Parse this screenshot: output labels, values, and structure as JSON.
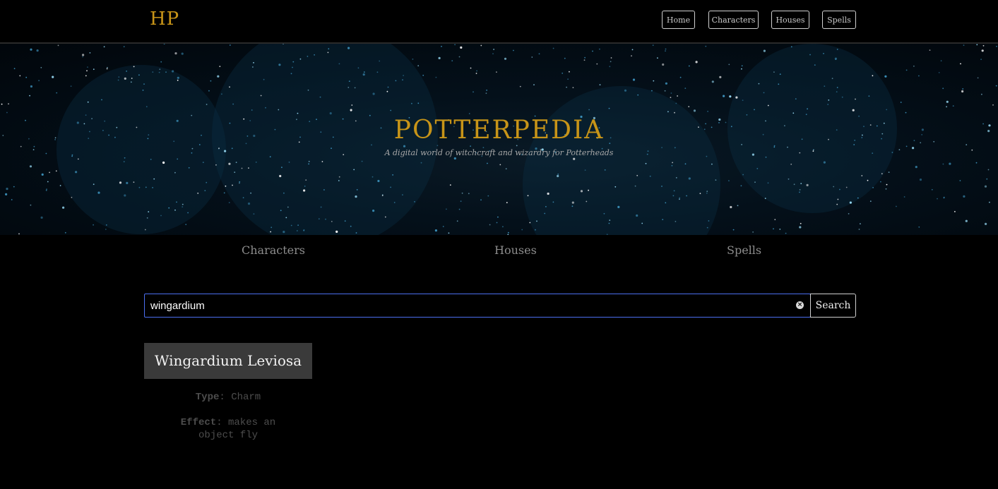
{
  "topbar": {
    "logo": "HP",
    "nav": [
      {
        "label": "Home"
      },
      {
        "label": "Characters"
      },
      {
        "label": "Houses"
      },
      {
        "label": "Spells"
      }
    ]
  },
  "hero": {
    "title": "POTTERPEDIA",
    "subtitle": "A digital world of witchcraft and wizardry for Potterheads"
  },
  "sections": [
    {
      "label": "Characters"
    },
    {
      "label": "Houses"
    },
    {
      "label": "Spells"
    }
  ],
  "search": {
    "value": "wingardium",
    "button_label": "Search"
  },
  "result": {
    "name": "Wingardium Leviosa",
    "type_label": "Type",
    "type_value": "Charm",
    "effect_label": "Effect",
    "effect_value": "makes an object fly"
  },
  "colors": {
    "accent": "#c79418",
    "background": "#000000",
    "focus_border": "#4b6ef0"
  }
}
